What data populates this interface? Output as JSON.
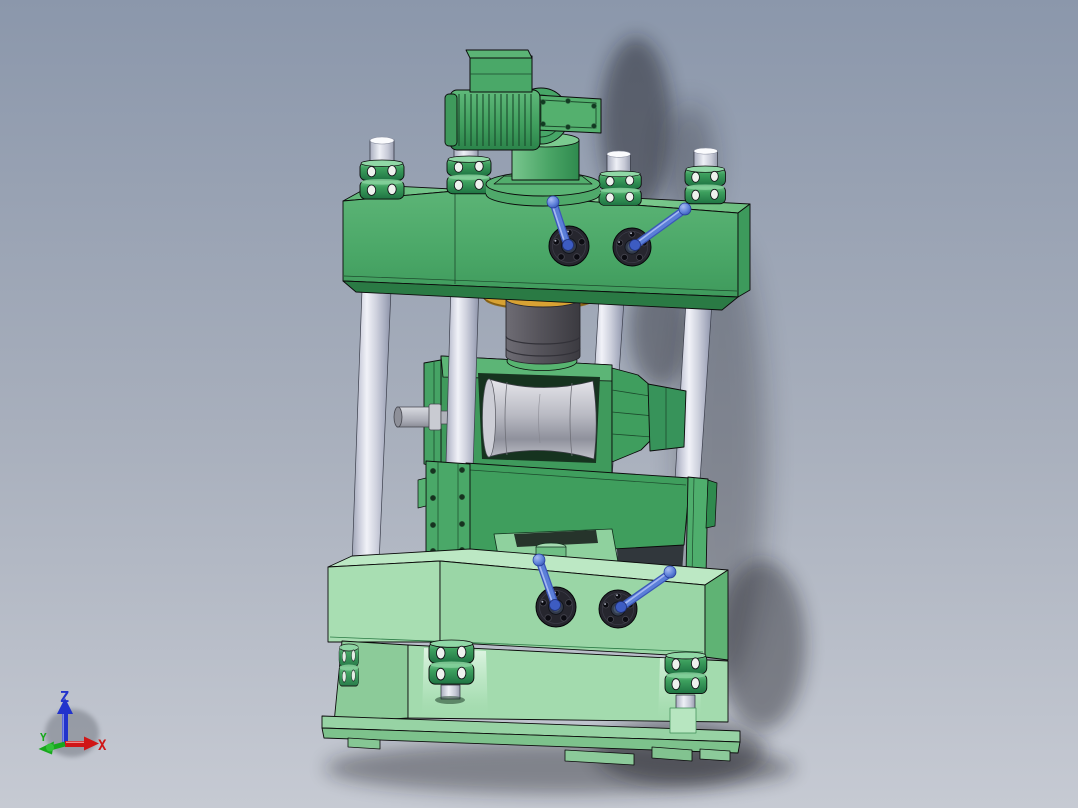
{
  "viewport": {
    "name": "3D CAD model viewport",
    "background_top": "#8b97ab",
    "background_bottom": "#c6cad3"
  },
  "orientation_triad": {
    "axes": [
      {
        "label": "Z",
        "color": "#2233cc",
        "direction": "up"
      },
      {
        "label": "X",
        "color": "#d01616",
        "direction": "right"
      },
      {
        "label": "Y",
        "color": "#17a81c",
        "direction": "lower-left"
      }
    ]
  },
  "model": {
    "name": "four-column press rolling machine assembly",
    "part_colors": {
      "frame_green": "#4fa96a",
      "frame_light_green": "#9ad6a6",
      "column_silver": "#dfe1ec",
      "roller_silver": "#b9bac4",
      "ram_dark_gray": "#55535a",
      "ring_gold": "#d8a233",
      "handle_blue": "#5b7fd8",
      "flange_black": "#26262e"
    }
  }
}
